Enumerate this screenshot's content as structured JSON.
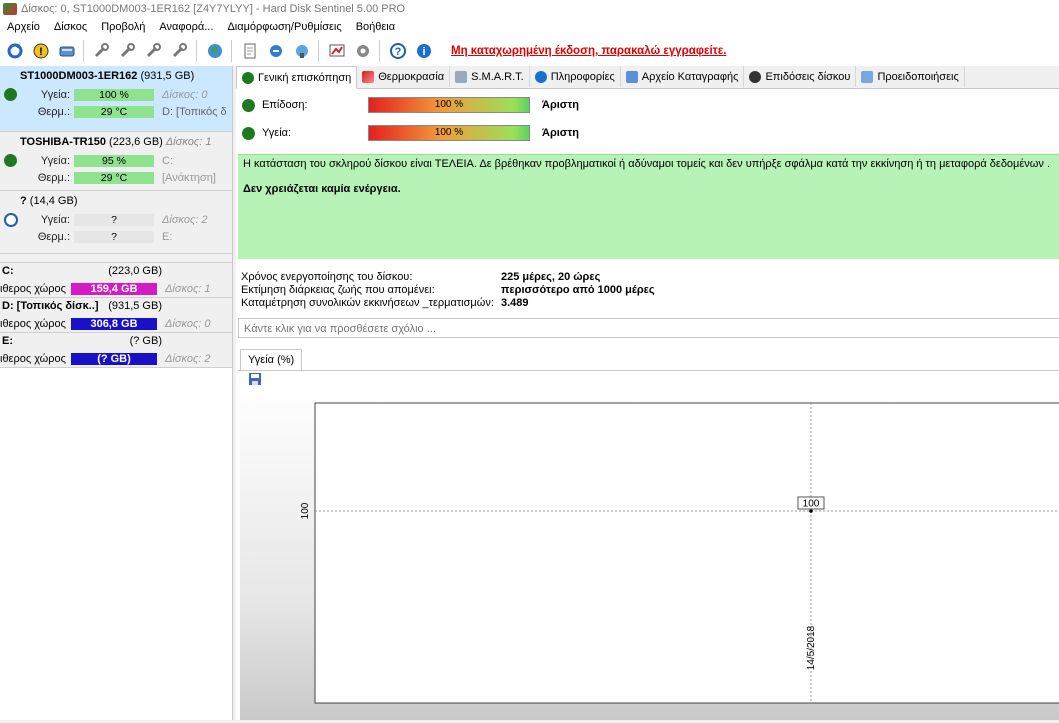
{
  "window": {
    "title": "Δίσκος: 0, ST1000DM003-1ER162 [Z4Y7YLYY]  -  Hard Disk Sentinel 5.00 PRO"
  },
  "menu": [
    "Αρχείο",
    "Δίσκος",
    "Προβολή",
    "Αναφορά...",
    "Διαμόρφωση/Ρυθμίσεις",
    "Βοήθεια"
  ],
  "toolbar": {
    "register_notice": "Μη καταχωρημένη έκδοση, παρακαλώ εγγραφείτε."
  },
  "disks": [
    {
      "name": "ST1000DM003-1ER162",
      "size": "(931,5 GB)",
      "disk_label": "",
      "health_label": "Υγεία:",
      "health": "100 %",
      "health_extra": "Δίσκος: 0",
      "temp_label": "Θερμ.:",
      "temp": "29 °C",
      "temp_extra": "D: [Τοπικός δ"
    },
    {
      "name": "TOSHIBA-TR150",
      "size": "(223,6 GB)",
      "disk_label": "Δίσκος: 1",
      "health_label": "Υγεία:",
      "health": "95 %",
      "health_extra": "C:",
      "temp_label": "Θερμ.:",
      "temp": "29 °C",
      "temp_extra": "[Ανάκτηση]"
    },
    {
      "name": "?",
      "size": "(14,4 GB)",
      "disk_label": "",
      "health_label": "Υγεία:",
      "health": "?",
      "health_extra": "Δίσκος: 2",
      "temp_label": "Θερμ.:",
      "temp": "?",
      "temp_extra": "E:"
    }
  ],
  "volumes": [
    {
      "name": "C:",
      "size": "(223,0 GB)",
      "free_label": "ιθερος χώρος",
      "free": "159,4 GB",
      "disk": "Δίσκος: 1",
      "color": "#d41cc4"
    },
    {
      "name": "D: [Τοπικός δίσκ..]",
      "size": "(931,5 GB)",
      "free_label": "ιθερος χώρος",
      "free": "306,8 GB",
      "disk": "Δίσκος: 0",
      "color": "#1a10c8"
    },
    {
      "name": "E:",
      "size": "(? GB)",
      "free_label": "ιθερος χώρος",
      "free": "(? GB)",
      "disk": "Δίσκος: 2",
      "color": "#1a10c8"
    }
  ],
  "tabs": [
    "Γενική επισκόπηση",
    "Θερμοκρασία",
    "S.M.A.R.T.",
    "Πληροφορίες",
    "Αρχείο Καταγραφής",
    "Επιδόσεις δίσκου",
    "Προειδοποιήσεις"
  ],
  "overview": {
    "performance_label": "Επίδοση:",
    "performance": "100 %",
    "performance_text": "Άριστη",
    "health_label": "Υγεία:",
    "health": "100 %",
    "health_text": "Άριστη",
    "status_text": "Η κατάσταση του σκληρού δίσκου είναι ΤΕΛΕΙΑ. Δε βρέθηκαν προβληματικοί ή αδύναμοι τομείς και δεν υπήρξε σφάλμα κατά την εκκίνηση ή τη μεταφορά δεδομένων .",
    "action_text": "Δεν χρειάζεται καμία ενέργεια.",
    "power_on_label": "Χρόνος ενεργοποίησης του δίσκου:",
    "power_on": "225 μέρες, 20 ώρες",
    "lifetime_label": "Εκτίμηση διάρκειας ζωής που απομένει:",
    "lifetime": "περισσότερο από 1000 μέρες",
    "startstop_label": "Καταμέτρηση συνολικών εκκινήσεων _τερματισμών:",
    "startstop": "3.489",
    "comment_placeholder": "Κάντε κλικ για να προσθέσετε σχόλιο ..."
  },
  "health_tab": {
    "label": "Υγεία (%)"
  },
  "chart_data": {
    "type": "line",
    "x": [
      "14/5/2018"
    ],
    "series": [
      {
        "values": [
          100
        ]
      }
    ],
    "ytick": "100",
    "data_label": "100"
  }
}
